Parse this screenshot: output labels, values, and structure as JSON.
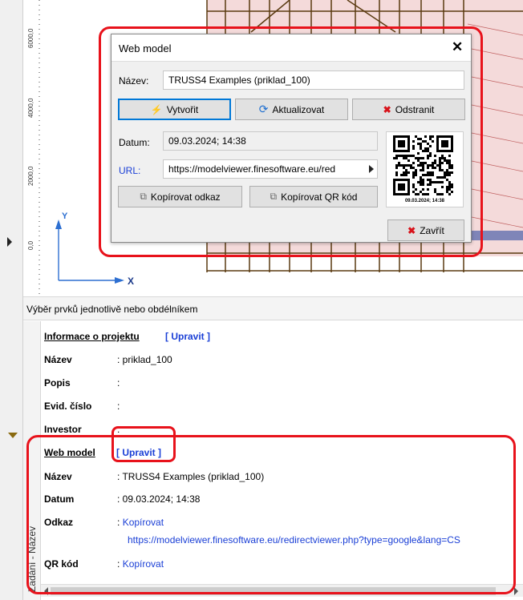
{
  "ruler": {
    "ticks": [
      "6000,0",
      "4000,0",
      "2000,0",
      "0,0"
    ]
  },
  "axes": {
    "y": "Y",
    "x": "X"
  },
  "status_bar": {
    "text": "Výběr prvků jednotlivě nebo obdélníkem"
  },
  "project_info": {
    "section_title": "Informace o projektu",
    "edit_label": "[ Upravit ]",
    "rows": [
      {
        "label": "Název",
        "value": ": priklad_100"
      },
      {
        "label": "Popis",
        "value": ":"
      },
      {
        "label": "Evid. číslo",
        "value": ":"
      },
      {
        "label": "Investor",
        "value": ":"
      }
    ]
  },
  "web_model_info": {
    "section_title": "Web model",
    "edit_label": "[ Upravit ]",
    "name_label": "Název",
    "name_value": ": TRUSS4 Examples (priklad_100)",
    "date_label": "Datum",
    "date_value": ": 09.03.2024; 14:38",
    "link_label": "Odkaz",
    "link_prefix": ":",
    "link_action": "Kopírovat",
    "link_url": "https://modelviewer.finesoftware.eu/redirectviewer.php?type=google&lang=CS",
    "qr_label": "QR kód",
    "qr_prefix": ":",
    "qr_action": "Kopírovat"
  },
  "side_tab": {
    "text": "Zadání - Název"
  },
  "dialog": {
    "title": "Web model",
    "close_glyph": "✕",
    "name_label": "Název:",
    "name_value": "TRUSS4 Examples (priklad_100)",
    "create_label": "Vytvořit",
    "update_label": "Aktualizovat",
    "remove_label": "Odstranit",
    "date_label": "Datum:",
    "date_value": "09.03.2024; 14:38",
    "url_label": "URL:",
    "url_value": "https://modelviewer.finesoftware.eu/red",
    "copy_link_label": "Kopírovat odkaz",
    "copy_qr_label": "Kopírovat QR kód",
    "qr_caption": "09.03.2024; 14:38",
    "close_label": "Zavřít"
  },
  "colors": {
    "highlight": "#e8121b",
    "link": "#1a3fd6",
    "structure": "#5a3a10",
    "grid_fill": "#f4dada"
  }
}
